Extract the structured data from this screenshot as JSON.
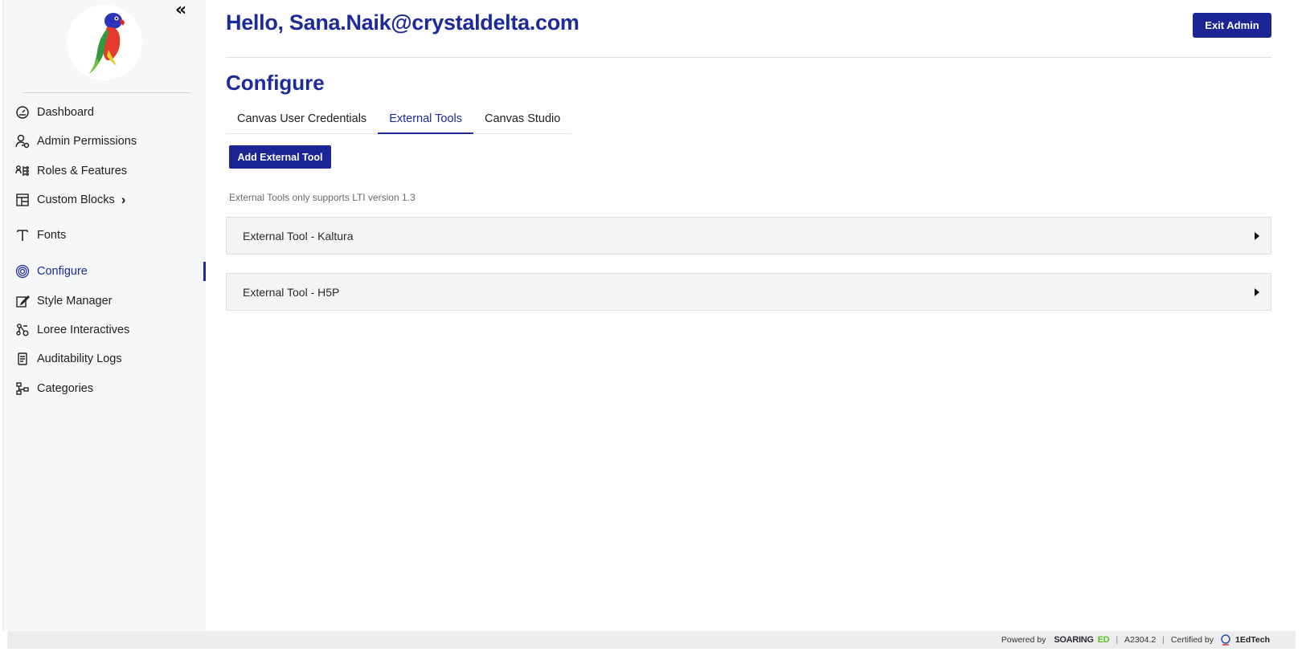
{
  "sidebar": {
    "collapse_glyph": "«",
    "items": [
      {
        "label": "Dashboard",
        "icon": "gauge-icon"
      },
      {
        "label": "Admin Permissions",
        "icon": "user-key-icon"
      },
      {
        "label": "Roles & Features",
        "icon": "roles-icon"
      },
      {
        "label": "Custom Blocks",
        "icon": "blocks-icon",
        "chevron": "›"
      },
      {
        "label": "Fonts",
        "icon": "font-icon"
      },
      {
        "label": "Configure",
        "icon": "fingerprint-icon",
        "active": true
      },
      {
        "label": "Style Manager",
        "icon": "edit-icon"
      },
      {
        "label": "Loree Interactives",
        "icon": "interactives-icon"
      },
      {
        "label": "Auditability Logs",
        "icon": "document-icon"
      },
      {
        "label": "Categories",
        "icon": "hierarchy-icon"
      }
    ]
  },
  "header": {
    "greeting": "Hello, Sana.Naik@crystaldelta.com",
    "exit_label": "Exit Admin"
  },
  "main": {
    "title": "Configure",
    "tabs": [
      {
        "label": "Canvas User Credentials",
        "active": false
      },
      {
        "label": "External Tools",
        "active": true
      },
      {
        "label": "Canvas Studio",
        "active": false
      }
    ],
    "add_button_label": "Add External Tool",
    "note": "External Tools only supports LTI version 1.3",
    "tools": [
      {
        "title": "External Tool - Kaltura"
      },
      {
        "title": "External Tool - H5P"
      }
    ]
  },
  "footer": {
    "powered_by": "Powered by",
    "brand_main": "SOARING",
    "brand_accent": "ED",
    "version": "A2304.2",
    "certified_by": "Certified by",
    "certifier": "1EdTech"
  },
  "colors": {
    "accent": "#1c2595",
    "sidebar_bg": "#f6f7f9",
    "brand_green": "#5cbf2a"
  }
}
